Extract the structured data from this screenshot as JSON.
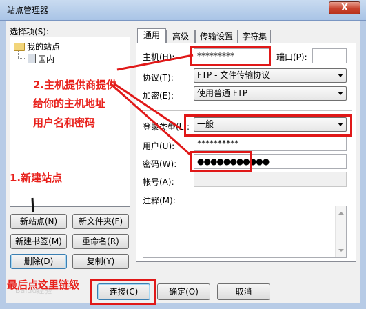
{
  "window": {
    "title": "站点管理器",
    "close_glyph": "X"
  },
  "select_label": "选择项(S):",
  "tree": {
    "root": "我的站点",
    "child": "国内"
  },
  "left_buttons": {
    "new_site": "新站点(N)",
    "new_folder": "新文件夹(F)",
    "new_bookmark": "新建书签(M)",
    "rename": "重命名(R)",
    "delete": "删除(D)",
    "copy": "复制(Y)"
  },
  "tabs": [
    "通用",
    "高级",
    "传输设置",
    "字符集"
  ],
  "form": {
    "host_label": "主机(H):",
    "host_value": "*********",
    "port_label": "端口(P):",
    "port_value": "",
    "protocol_label": "协议(T):",
    "protocol_value": "FTP - 文件传输协议",
    "encryption_label": "加密(E):",
    "encryption_value": "使用普通 FTP",
    "logon_label": "登录类型(L):",
    "logon_value": "一般",
    "user_label": "用户(U):",
    "user_value": "**********",
    "password_label": "密码(W):",
    "password_value": "●●●●●●●●●●●",
    "account_label": "帐号(A):",
    "account_value": "",
    "comment_label": "注释(M):",
    "comment_value": ""
  },
  "bottom_buttons": {
    "connect": "连接(C)",
    "ok": "确定(O)",
    "cancel": "取消"
  },
  "annotations": {
    "step1": "1.新建站点",
    "step2_line1": "2.主机提供商提供",
    "step2_line2": "给你的主机地址",
    "step2_line3": "用户名和密码",
    "last": "最后点这里链级"
  },
  "watermark": "Baidu经验",
  "colors": {
    "annotation_red": "#e01818",
    "title_bar": "#b7cbe6"
  }
}
